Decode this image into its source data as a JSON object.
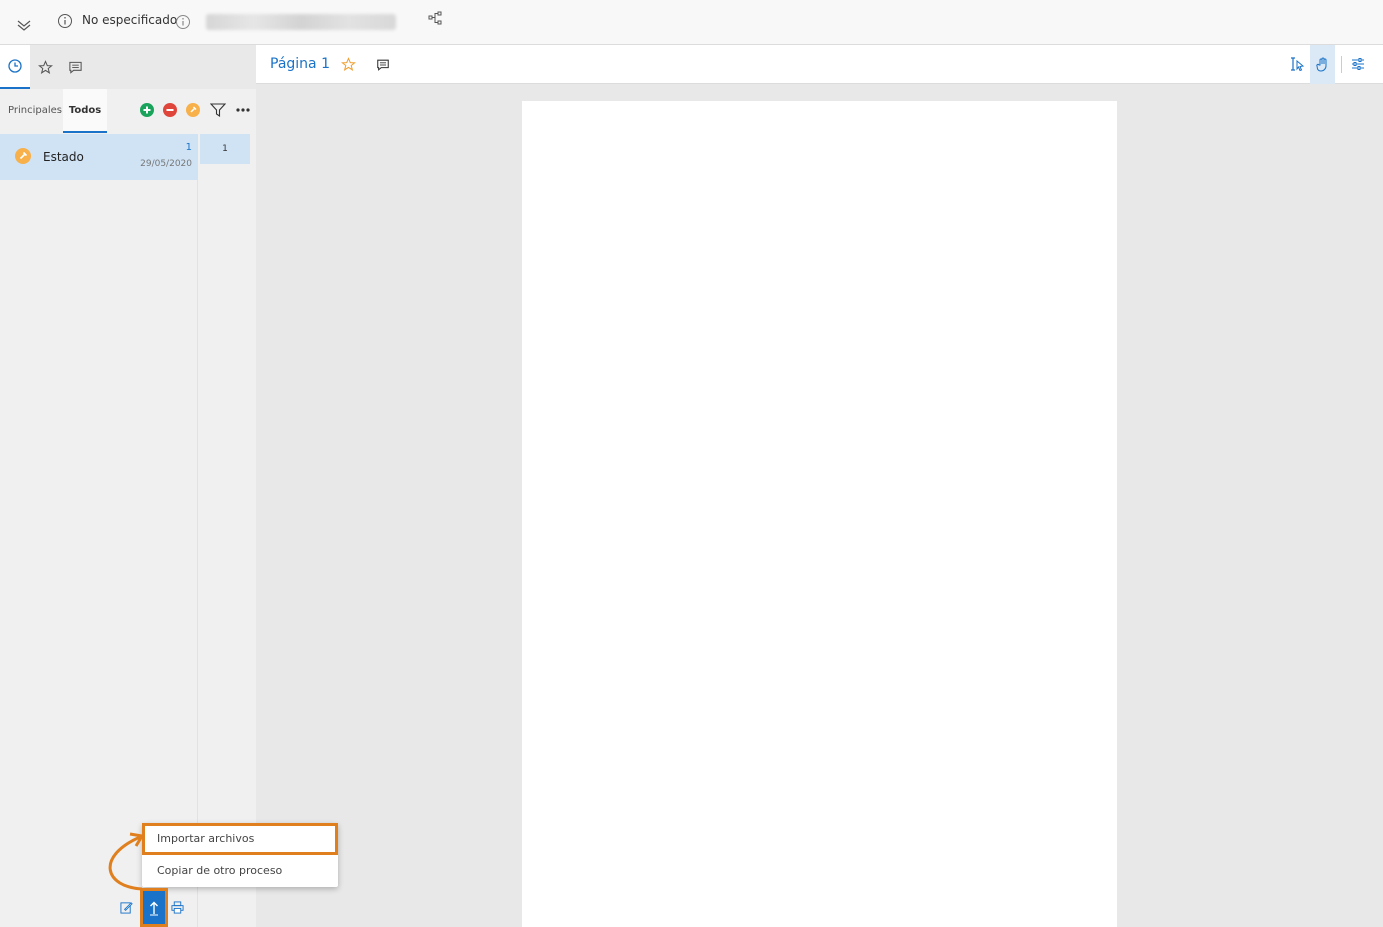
{
  "topbar": {
    "status_label": "No especificado"
  },
  "left_panel": {
    "tabs": [
      "history-icon",
      "star-icon",
      "comment-icon"
    ],
    "subtabs": {
      "principales": "Principales",
      "todos": "Todos"
    },
    "items": [
      {
        "name": "Estado",
        "count": "1",
        "date": "29/05/2020"
      }
    ],
    "page_list": [
      "1"
    ],
    "context_menu": {
      "import_files": "Importar archivos",
      "copy_from_process": "Copiar de otro proceso"
    }
  },
  "viewer": {
    "page_title": "Página 1"
  },
  "colors": {
    "accent": "#1a73c8",
    "highlight": "#e07f1e",
    "selected_row": "#cfe3f5",
    "green": "#1aa35b",
    "red": "#e0453b",
    "orange": "#f7b04a"
  }
}
